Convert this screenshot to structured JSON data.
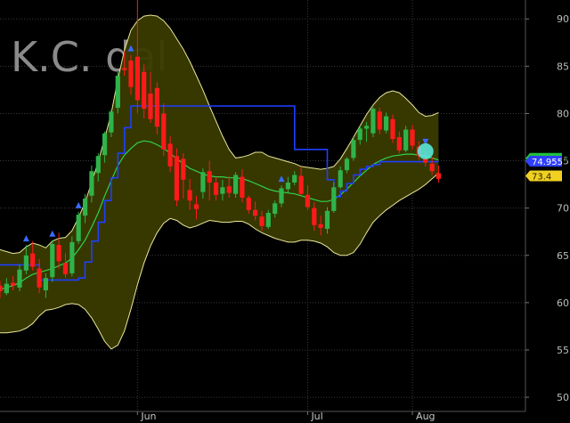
{
  "chart_data": {
    "type": "candlestick",
    "title": "K.C. Jindal",
    "watermark_visible_text": "K.C.  dal",
    "x_tick_labels": [
      "Jun",
      "Jul",
      "Aug"
    ],
    "y_ticks": [
      50,
      55,
      60,
      65,
      70,
      75,
      80,
      85,
      90
    ],
    "ylim": [
      48.5,
      92
    ],
    "grid": true,
    "axis_side": "right",
    "colors": {
      "background": "#000000",
      "grid": "#3a3a3a",
      "up_candle": "#2fb34a",
      "down_candle": "#ff1a1a",
      "band_fill": "#3a3a00",
      "band_edge": "#e8e89a",
      "moving_average": "#2fd34a",
      "supertrend": "#1f3fff",
      "arrow": "#3a6bff",
      "marker": "#5cf0e8"
    },
    "series": [
      {
        "kind": "candles",
        "ohlc": [
          [
            61.8,
            62.3,
            60.5,
            61.2
          ],
          [
            61.0,
            62.6,
            60.8,
            62.0
          ],
          [
            62.1,
            62.8,
            61.3,
            61.8
          ],
          [
            61.6,
            64.0,
            61.2,
            63.5
          ],
          [
            63.4,
            66.1,
            63.0,
            65.0
          ],
          [
            65.2,
            66.5,
            63.4,
            63.8
          ],
          [
            63.6,
            64.6,
            61.0,
            61.6
          ],
          [
            61.3,
            63.1,
            60.5,
            62.6
          ],
          [
            62.7,
            66.6,
            62.2,
            66.2
          ],
          [
            66.1,
            67.4,
            63.6,
            64.4
          ],
          [
            64.2,
            65.2,
            62.6,
            63.0
          ],
          [
            63.1,
            67.0,
            62.8,
            66.4
          ],
          [
            66.5,
            69.6,
            66.2,
            69.3
          ],
          [
            69.2,
            71.5,
            68.4,
            71.0
          ],
          [
            71.3,
            74.5,
            70.6,
            73.9
          ],
          [
            73.7,
            75.8,
            72.8,
            75.5
          ],
          [
            75.6,
            78.1,
            74.8,
            77.9
          ],
          [
            78.0,
            80.4,
            77.5,
            80.2
          ],
          [
            80.6,
            84.4,
            80.0,
            84.0
          ],
          [
            84.8,
            86.6,
            84.0,
            84.6
          ],
          [
            85.6,
            86.2,
            82.0,
            82.8
          ],
          [
            86.0,
            92.0,
            80.0,
            81.4
          ],
          [
            84.4,
            85.2,
            79.5,
            80.5
          ],
          [
            82.1,
            84.4,
            79.0,
            79.4
          ],
          [
            82.7,
            83.3,
            77.8,
            78.6
          ],
          [
            80.0,
            81.1,
            75.5,
            76.2
          ],
          [
            76.8,
            77.6,
            73.8,
            74.4
          ],
          [
            75.5,
            76.3,
            70.2,
            70.8
          ],
          [
            75.2,
            75.8,
            71.0,
            73.0
          ],
          [
            71.9,
            73.1,
            69.8,
            70.8
          ],
          [
            70.4,
            71.3,
            68.8,
            69.9
          ],
          [
            71.7,
            74.2,
            71.0,
            73.8
          ],
          [
            73.9,
            75.0,
            70.8,
            72.7
          ],
          [
            72.7,
            73.3,
            70.8,
            71.4
          ],
          [
            71.5,
            73.0,
            70.8,
            72.2
          ],
          [
            72.3,
            73.4,
            71.1,
            71.6
          ],
          [
            71.5,
            73.8,
            71.1,
            73.5
          ],
          [
            73.3,
            74.1,
            70.6,
            71.1
          ],
          [
            71.1,
            71.3,
            69.4,
            69.8
          ],
          [
            69.8,
            70.7,
            68.7,
            69.2
          ],
          [
            69.1,
            69.7,
            67.6,
            68.1
          ],
          [
            68.0,
            69.8,
            67.8,
            69.5
          ],
          [
            69.4,
            70.8,
            69.0,
            70.5
          ],
          [
            70.5,
            72.4,
            70.1,
            72.1
          ],
          [
            72.0,
            73.3,
            71.6,
            72.7
          ],
          [
            72.7,
            73.9,
            72.4,
            73.5
          ],
          [
            73.4,
            74.4,
            71.3,
            71.5
          ],
          [
            71.4,
            72.4,
            69.8,
            70.1
          ],
          [
            70.0,
            70.6,
            67.6,
            68.2
          ],
          [
            68.3,
            69.2,
            67.1,
            67.9
          ],
          [
            67.8,
            70.1,
            67.3,
            69.7
          ],
          [
            69.7,
            72.7,
            69.5,
            72.2
          ],
          [
            72.2,
            74.4,
            72.0,
            74.0
          ],
          [
            74.0,
            75.4,
            73.7,
            75.2
          ],
          [
            75.3,
            77.5,
            75.0,
            77.2
          ],
          [
            77.2,
            78.7,
            76.7,
            78.4
          ],
          [
            78.4,
            79.1,
            77.0,
            78.7
          ],
          [
            77.9,
            80.7,
            77.5,
            80.5
          ],
          [
            80.2,
            80.6,
            77.8,
            78.3
          ],
          [
            78.2,
            80.1,
            77.9,
            79.7
          ],
          [
            79.4,
            79.9,
            76.9,
            77.3
          ],
          [
            77.5,
            78.1,
            75.8,
            76.1
          ],
          [
            76.1,
            78.7,
            75.9,
            78.3
          ],
          [
            78.3,
            78.8,
            76.2,
            76.6
          ],
          [
            76.5,
            77.1,
            75.1,
            75.5
          ],
          [
            75.3,
            76.0,
            74.4,
            74.8
          ],
          [
            74.7,
            75.4,
            73.5,
            73.9
          ],
          [
            73.7,
            74.5,
            72.7,
            73.1
          ]
        ]
      },
      {
        "name": "",
        "kind": "moving_average",
        "values": [
          61.4,
          61.6,
          61.8,
          62.1,
          62.6,
          63.0,
          63.2,
          63.4,
          63.6,
          63.9,
          64.2,
          64.7,
          65.6,
          66.6,
          68.0,
          69.5,
          71.3,
          72.9,
          74.5,
          75.6,
          76.3,
          76.9,
          77.1,
          77.0,
          76.7,
          76.3,
          75.8,
          75.2,
          74.7,
          74.2,
          73.9,
          73.6,
          73.4,
          73.3,
          73.3,
          73.2,
          73.2,
          73.1,
          72.9,
          72.6,
          72.3,
          72.0,
          71.8,
          71.7,
          71.6,
          71.5,
          71.3,
          71.1,
          70.9,
          70.7,
          70.7,
          70.9,
          71.4,
          72.0,
          72.7,
          73.4,
          74.0,
          74.6,
          75.0,
          75.3,
          75.5,
          75.6,
          75.7,
          75.7,
          75.6,
          75.5,
          75.3,
          75.1
        ]
      },
      {
        "name": "",
        "kind": "supertrend",
        "values": [
          64.0,
          64.0,
          64.0,
          64.0,
          64.0,
          64.0,
          62.4,
          62.4,
          62.4,
          62.4,
          62.4,
          62.4,
          62.6,
          64.3,
          66.5,
          68.5,
          70.8,
          73.2,
          75.8,
          78.5,
          80.8,
          80.8,
          80.8,
          80.8,
          80.8,
          80.8,
          80.8,
          80.8,
          80.8,
          80.8,
          80.8,
          80.8,
          80.8,
          80.8,
          80.8,
          80.8,
          80.8,
          80.8,
          80.8,
          80.8,
          80.8,
          80.8,
          80.8,
          80.8,
          80.8,
          76.2,
          76.2,
          76.2,
          76.2,
          76.2,
          73.0,
          71.2,
          71.8,
          72.6,
          73.5,
          74.1,
          74.4,
          74.6,
          74.9,
          74.9,
          74.9,
          74.9,
          74.9,
          74.9,
          74.9,
          74.9,
          74.9,
          74.9
        ]
      },
      {
        "name": "",
        "kind": "bollinger_upper",
        "values": [
          65.6,
          65.4,
          65.2,
          65.3,
          65.9,
          66.3,
          66.1,
          65.8,
          66.5,
          66.8,
          66.9,
          67.6,
          69.0,
          70.6,
          72.7,
          74.9,
          77.4,
          80.0,
          83.6,
          86.7,
          88.8,
          89.8,
          90.3,
          90.4,
          90.3,
          89.8,
          89.0,
          87.9,
          86.8,
          85.5,
          84.0,
          82.5,
          80.8,
          79.2,
          77.6,
          76.2,
          75.3,
          75.4,
          75.6,
          75.9,
          75.9,
          75.5,
          75.3,
          75.1,
          74.9,
          74.7,
          74.4,
          74.3,
          74.2,
          74.1,
          74.2,
          74.4,
          75.2,
          76.3,
          77.5,
          78.7,
          79.9,
          80.9,
          81.7,
          82.2,
          82.4,
          82.2,
          81.6,
          80.9,
          80.1,
          79.7,
          79.8,
          80.1
        ]
      },
      {
        "name": "",
        "kind": "bollinger_lower",
        "values": [
          56.8,
          56.8,
          56.9,
          57.0,
          57.3,
          57.8,
          58.6,
          59.2,
          59.3,
          59.5,
          59.8,
          59.9,
          59.8,
          59.3,
          58.4,
          57.2,
          55.9,
          55.1,
          55.5,
          57.0,
          59.3,
          61.9,
          64.2,
          66.0,
          67.4,
          68.4,
          68.9,
          68.7,
          68.2,
          67.9,
          68.1,
          68.4,
          68.7,
          68.6,
          68.5,
          68.5,
          68.6,
          68.6,
          68.3,
          67.8,
          67.4,
          67.1,
          66.8,
          66.6,
          66.4,
          66.4,
          66.6,
          66.6,
          66.5,
          66.3,
          65.9,
          65.3,
          65.0,
          65.0,
          65.3,
          66.2,
          67.4,
          68.5,
          69.2,
          69.8,
          70.3,
          70.8,
          71.2,
          71.6,
          72.0,
          72.5,
          73.1,
          73.7
        ]
      }
    ],
    "signal_arrows": [
      {
        "bar": 4,
        "direction": "up"
      },
      {
        "bar": 8,
        "direction": "up"
      },
      {
        "bar": 12,
        "direction": "up"
      },
      {
        "bar": 20,
        "direction": "up"
      },
      {
        "bar": 43,
        "direction": "up"
      },
      {
        "bar": 65,
        "direction": "down"
      }
    ],
    "marker": {
      "bar": 65,
      "value": 76.0
    },
    "value_tags": [
      {
        "label": "75.2589",
        "value": 75.2589,
        "color": "#1fbf3f",
        "text_color": "#0a2a0a"
      },
      {
        "label": "74.955",
        "value": 74.955,
        "color": "#2f3fff",
        "text_color": "#ffffff"
      },
      {
        "label": "73.4",
        "value": 73.4,
        "color": "#f0d020",
        "text_color": "#2a2000"
      }
    ],
    "x_tick_bars": {
      "Jun": 21,
      "Jul": 47,
      "Aug": 63
    }
  }
}
